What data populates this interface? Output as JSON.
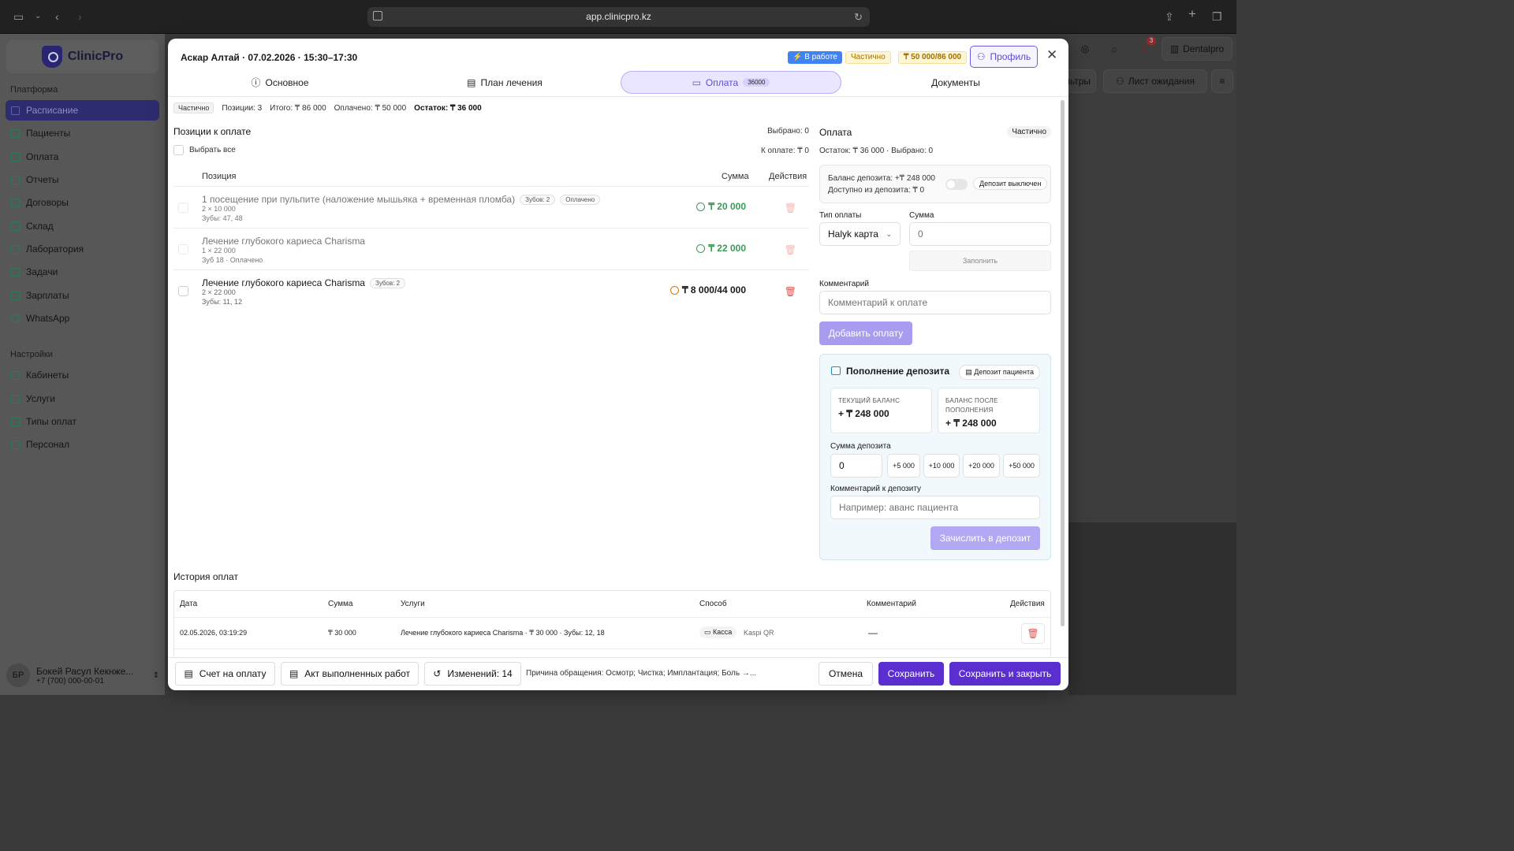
{
  "browser": {
    "url": "app.clinicpro.kz"
  },
  "app": {
    "name": "ClinicPro",
    "section_platform": "Платформа",
    "section_settings": "Настройки",
    "nav": [
      "Расписание",
      "Пациенты",
      "Оплата",
      "Отчеты",
      "Договоры",
      "Склад",
      "Лаборатория",
      "Задачи",
      "Зарплаты",
      "WhatsApp"
    ],
    "settings_nav": [
      "Кабинеты",
      "Услуги",
      "Типы оплат",
      "Персонал"
    ],
    "user": {
      "initials": "БР",
      "name": "Бокей Расул Кекнже...",
      "phone": "+7 (700) 000-00-01"
    },
    "top_right": {
      "notif_count": "3",
      "clinic": "Dentalpro",
      "filters_partial": "льтры",
      "waitlist": "Лист ожидания"
    }
  },
  "modal": {
    "title": "Аскар Алтай · 07.02.2026 · 15:30–17:30",
    "badge_status": "В работе",
    "badge_payment": "Частично",
    "badge_sum": "₸ 50 000/86 000",
    "profile_btn": "Профиль",
    "tabs": [
      {
        "label": "Основное"
      },
      {
        "label": "План лечения"
      },
      {
        "label": "Оплата",
        "count": "36000"
      },
      {
        "label": "Документы"
      }
    ],
    "summary": {
      "chip": "Частично",
      "positions": "Позиции: 3",
      "total": "Итого: ₸ 86 000",
      "paid": "Оплачено: ₸ 50 000",
      "rest": "Остаток: ₸ 36 000"
    },
    "positions": {
      "title": "Позиции к оплате",
      "selected": "Выбрано: 0",
      "select_all": "Выбрать все",
      "to_pay": "К оплате: ₸ 0",
      "headers": {
        "position": "Позиция",
        "sum": "Сумма",
        "actions": "Действия"
      },
      "rows": [
        {
          "name": "1 посещение при пульпите (наложение мышьяка + временная пломба)",
          "pill": "Зубов: 2",
          "pill2": "Оплачено",
          "sub1": "2 × 10 000",
          "sub2": "Зубы: 47, 48",
          "amount": "₸ 20 000",
          "state": "paid"
        },
        {
          "name": "Лечение глубокого кариеса Charisma",
          "pill": "",
          "pill2": "",
          "sub1": "1 × 22 000",
          "sub2": "Зуб 18 · Оплачено",
          "amount": "₸ 22 000",
          "state": "paid"
        },
        {
          "name": "Лечение глубокого кариеса Charisma",
          "pill": "Зубов: 2",
          "pill2": "",
          "sub1": "2 × 22 000",
          "sub2": "Зубы: 11, 12",
          "amount": "₸ 8 000/44 000",
          "state": "partial"
        }
      ]
    },
    "payment": {
      "title": "Оплата",
      "chip": "Частично",
      "rest_line": "Остаток: ₸ 36 000 · Выбрано: 0",
      "deposit_balance": "Баланс депозита: +₸ 248 000",
      "deposit_available": "Доступно из депозита: ₸ 0",
      "deposit_off": "Депозит выключен",
      "type_label": "Тип оплаты",
      "type_value": "Halyk карта",
      "sum_label": "Сумма",
      "sum_placeholder": "0",
      "fill_btn": "Заполнить",
      "comment_label": "Комментарий",
      "comment_placeholder": "Комментарий к оплате",
      "add_btn": "Добавить оплату"
    },
    "deposit": {
      "title": "Пополнение депозита",
      "patient_deposit": "Депозит пациента",
      "current_label": "ТЕКУЩИЙ БАЛАНС",
      "current_value": "+ ₸ 248 000",
      "after_label_1": "БАЛАНС ПОСЛЕ",
      "after_label_2": "ПОПОЛНЕНИЯ",
      "after_value": "+ ₸ 248 000",
      "sum_label": "Сумма депозита",
      "sum_value": "0",
      "quick": [
        "+5 000",
        "+10 000",
        "+20 000",
        "+50 000"
      ],
      "comment_label": "Комментарий к депозиту",
      "comment_placeholder": "Например: аванс пациента",
      "credit_btn": "Зачислить в депозит"
    },
    "history": {
      "title": "История оплат",
      "headers": {
        "date": "Дата",
        "sum": "Сумма",
        "services": "Услуги",
        "method": "Способ",
        "comment": "Комментарий",
        "actions": "Действия"
      },
      "rows": [
        {
          "date": "02.05.2026, 03:19:29",
          "sum": "₸ 30 000",
          "services": "Лечение глубокого кариеса Charisma · ₸ 30 000 · Зубы: 12, 18",
          "method_chip": "Касса",
          "method": "Kaspi QR",
          "comment": "—"
        }
      ]
    },
    "footer": {
      "invoice": "Счет на оплату",
      "act": "Акт выполненных работ",
      "changes": "Изменений: 14",
      "reason": "Причина обращения: Осмотр; Чистка; Имплантация; Боль →...",
      "cancel": "Отмена",
      "save": "Сохранить",
      "save_close": "Сохранить и закрыть"
    }
  }
}
